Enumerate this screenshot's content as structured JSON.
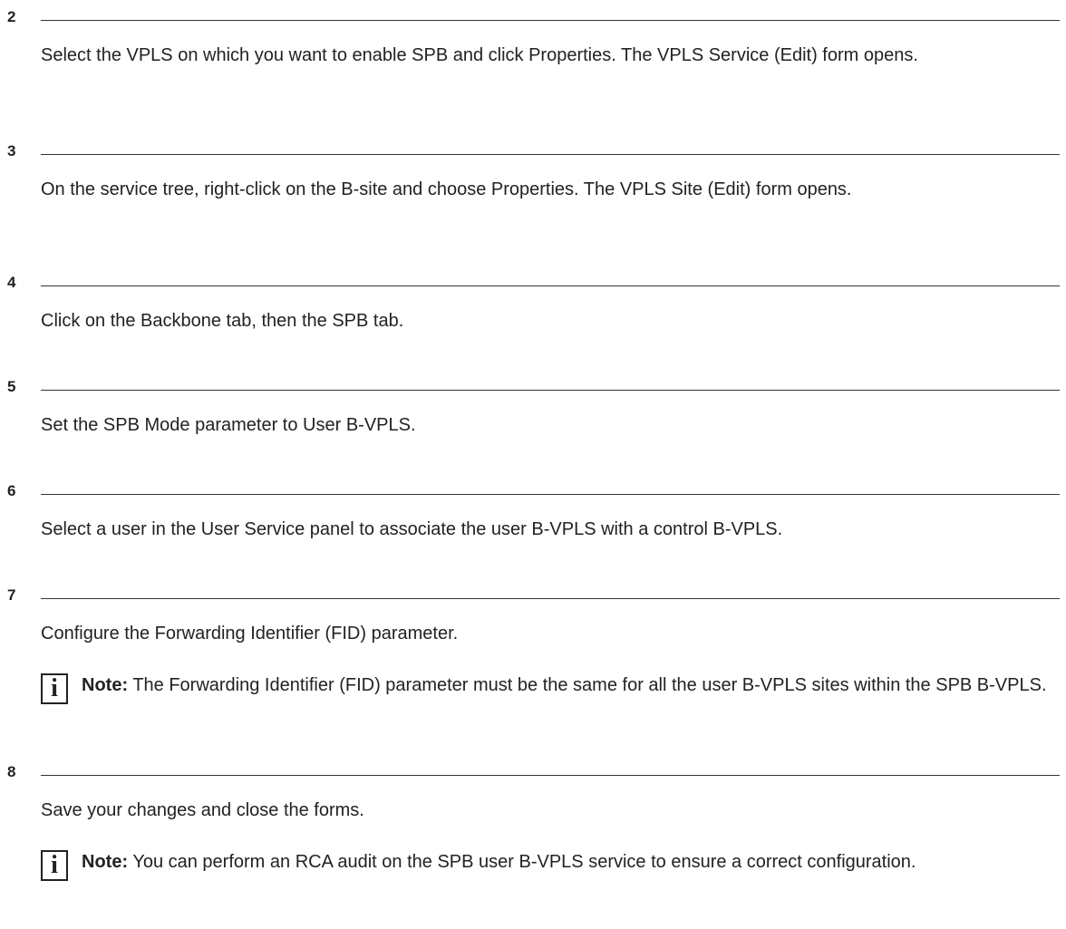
{
  "steps": [
    {
      "number": "2",
      "text": "Select the VPLS on which you want to enable SPB and click Properties. The VPLS Service (Edit) form opens."
    },
    {
      "number": "3",
      "text": "On the service tree, right-click on the B-site and choose Properties. The VPLS Site (Edit) form opens."
    },
    {
      "number": "4",
      "text": "Click on the Backbone tab, then the SPB tab."
    },
    {
      "number": "5",
      "text": "Set the SPB Mode parameter to User B-VPLS."
    },
    {
      "number": "6",
      "text": "Select a user in the User Service panel to associate the user B-VPLS with a control B-VPLS."
    },
    {
      "number": "7",
      "text": "Configure the Forwarding Identifier (FID) parameter.",
      "note": {
        "icon": "info-icon",
        "label": "Note:",
        "text": "The Forwarding Identifier (FID) parameter must be the same for all the user B-VPLS sites within the SPB B-VPLS."
      }
    },
    {
      "number": "8",
      "text": "Save your changes and close the forms.",
      "note": {
        "icon": "info-icon",
        "label": "Note:",
        "text": "You can perform an RCA audit on the SPB user B-VPLS service to ensure a correct configuration."
      }
    }
  ]
}
